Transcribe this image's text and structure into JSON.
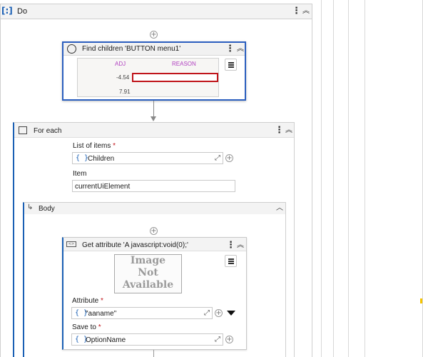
{
  "do_sequence": {
    "title": "Do"
  },
  "find_children": {
    "title": "Find children 'BUTTON  menu1'",
    "preview": {
      "col_adj": "ADJ",
      "col_reason": "REASON",
      "val_1": "-4.54",
      "val_2": "7.91"
    }
  },
  "for_each": {
    "title": "For each",
    "list_label": "List of items",
    "list_value": "Children",
    "item_label": "Item",
    "item_value": "currentUiElement",
    "required_mark": "*"
  },
  "body": {
    "title": "Body"
  },
  "get_attribute": {
    "title": "Get attribute 'A  javascript:void(0);'",
    "image_placeholder": [
      "Image",
      "Not",
      "Available"
    ],
    "attribute_label": "Attribute",
    "attribute_value": "\"aaname\"",
    "save_label": "Save to",
    "save_value": "OptionName"
  },
  "icons": {
    "brace": "{ }",
    "plus": "+",
    "kebab": "⋮",
    "collapse": "︽",
    "chevron_up": "︿",
    "expand": "⤢",
    "body_arrow": "↳"
  },
  "colors": {
    "accent": "#1a5fb4",
    "selected_border": "#2b5fbf",
    "highlight_red": "#c0141a",
    "preview_header": "#b040c0"
  }
}
